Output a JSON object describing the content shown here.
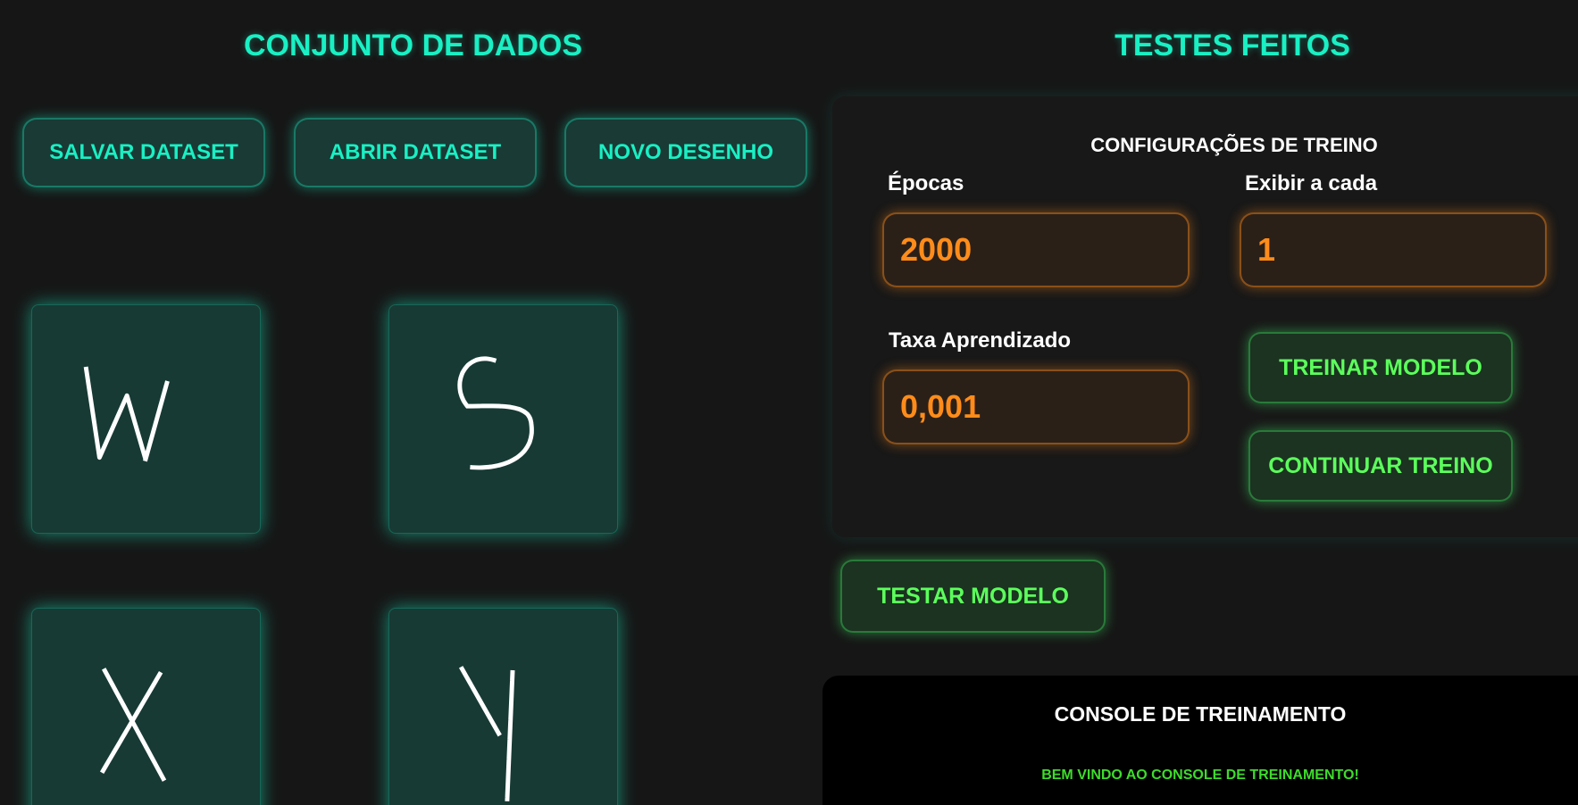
{
  "dataset": {
    "title": "CONJUNTO DE DADOS",
    "buttons": {
      "save": "SALVAR DATASET",
      "open": "ABRIR DATASET",
      "new_drawing": "NOVO DESENHO"
    },
    "drawings": [
      {
        "letter": "W"
      },
      {
        "letter": "S"
      },
      {
        "letter": "X"
      },
      {
        "letter": "Y"
      }
    ]
  },
  "tests": {
    "title": "TESTES FEITOS",
    "config": {
      "title": "CONFIGURAÇÕES DE TREINO",
      "epochs_label": "Épocas",
      "epochs_value": "2000",
      "display_every_label": "Exibir a cada",
      "display_every_value": "1",
      "learning_rate_label": "Taxa Aprendizado",
      "learning_rate_value": "0,001",
      "train_button": "TREINAR MODELO",
      "continue_button": "CONTINUAR TREINO"
    },
    "test_button": "TESTAR MODELO"
  },
  "console": {
    "title": "CONSOLE DE TREINAMENTO",
    "lines": [
      "BEM VINDO AO CONSOLE DE TREINAMENTO!"
    ]
  },
  "colors": {
    "background": "#161616",
    "accent_teal": "#19f0c4",
    "accent_orange": "#ff8c1a",
    "accent_green": "#5cff5c",
    "console_text": "#3ddc2b"
  }
}
